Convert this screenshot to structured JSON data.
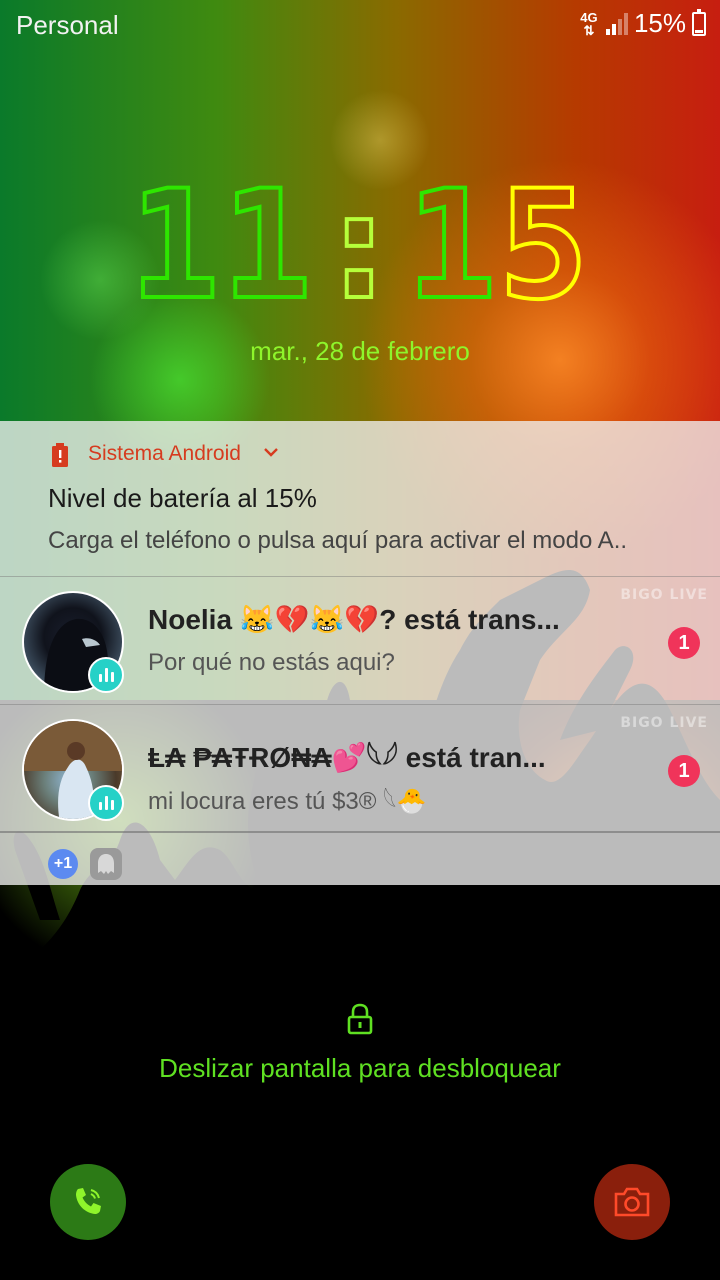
{
  "status_bar": {
    "carrier": "Personal",
    "network": "4G",
    "battery_percent": "15%"
  },
  "clock": {
    "hour": "11",
    "separator": ":",
    "minute_tens": "1",
    "minute_ones": "5"
  },
  "date": "mar., 28 de febrero",
  "notifications": {
    "system": {
      "app_name": "Sistema Android",
      "title": "Nivel de batería al 15%",
      "text": "Carga el teléfono o pulsa aquí para activar el modo A.."
    },
    "items": [
      {
        "title": "Noelia 😹💔😹💔? está trans...",
        "text": "Por qué no estás aqui?",
        "count": "1",
        "watermark": "BIGO LIVE"
      },
      {
        "title": "Ⱡ₳ ₱₳ŦɌØ₦₳💕𓆩𓆪 está tran...",
        "text": "mi locura eres tú $3® 𓆩🐣",
        "count": "1",
        "watermark": "BIGO LIVE"
      }
    ],
    "overflow_count": "+1"
  },
  "unlock": {
    "hint": "Deslizar pantalla para desbloquear"
  },
  "colors": {
    "clock_green": "#2ee600",
    "clock_yellow": "#ffff00",
    "accent_green": "#5fe022",
    "system_app_red": "#d63b1f",
    "badge_pink": "#f0345a",
    "live_teal": "#26d1c7"
  },
  "icons": {
    "battery_alert": "battery-alert-icon",
    "expand": "chevron-down-icon",
    "lock": "lock-icon",
    "phone": "phone-icon",
    "camera": "camera-icon",
    "live": "live-bars-icon"
  }
}
